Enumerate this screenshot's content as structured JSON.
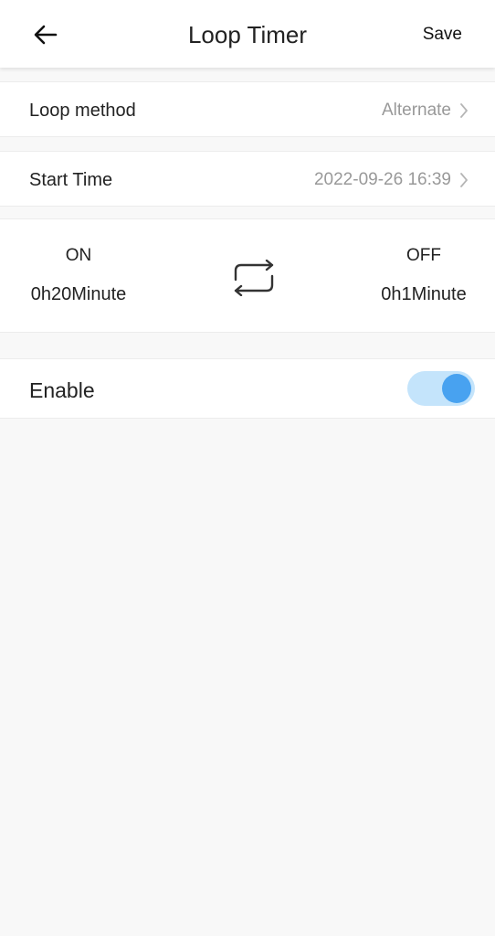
{
  "header": {
    "title": "Loop Timer",
    "save_label": "Save",
    "back_icon": "arrow-left-icon"
  },
  "loop_method": {
    "label": "Loop method",
    "value": "Alternate"
  },
  "start_time": {
    "label": "Start Time",
    "value": "2022-09-26 16:39"
  },
  "timer": {
    "on_label": "ON",
    "on_value": "0h20Minute",
    "off_label": "OFF",
    "off_value": "0h1Minute",
    "icon": "repeat-icon"
  },
  "enable": {
    "label": "Enable",
    "enabled": true,
    "track_color": "#c4e4fb",
    "knob_color": "#48a2f0"
  }
}
